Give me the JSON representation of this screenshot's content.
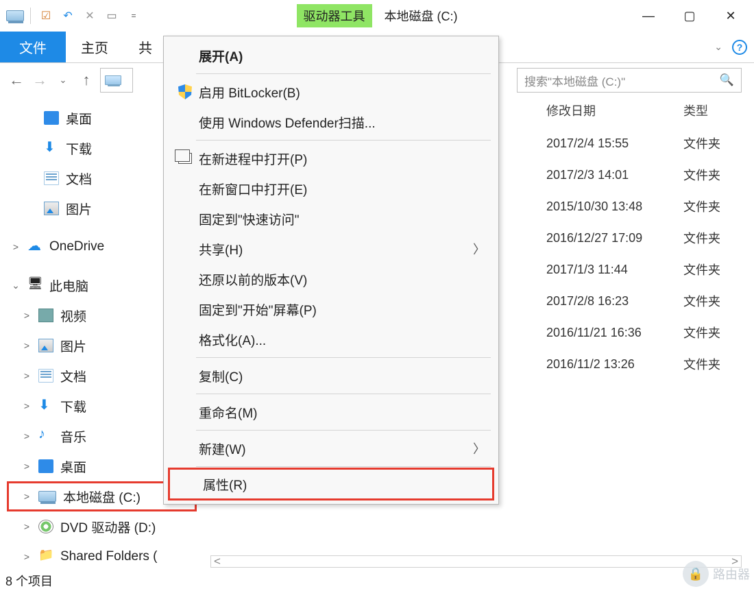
{
  "window": {
    "drive_tools_label": "驱动器工具",
    "title": "本地磁盘 (C:)"
  },
  "ribbon": {
    "file": "文件",
    "home": "主页",
    "partial": "共"
  },
  "nav": {
    "search_placeholder": "搜索\"本地磁盘 (C:)\""
  },
  "tree": {
    "quick": [
      {
        "label": "桌面",
        "icon": "desktop"
      },
      {
        "label": "下载",
        "icon": "download"
      },
      {
        "label": "文档",
        "icon": "doc"
      },
      {
        "label": "图片",
        "icon": "pic"
      }
    ],
    "onedrive": "OneDrive",
    "this_pc": "此电脑",
    "pc_children": [
      {
        "label": "视频",
        "icon": "video"
      },
      {
        "label": "图片",
        "icon": "pic"
      },
      {
        "label": "文档",
        "icon": "doc"
      },
      {
        "label": "下载",
        "icon": "download"
      },
      {
        "label": "音乐",
        "icon": "music"
      },
      {
        "label": "桌面",
        "icon": "desktop"
      },
      {
        "label": "本地磁盘 (C:)",
        "icon": "drive",
        "selected": true
      },
      {
        "label": "DVD 驱动器 (D:)",
        "icon": "dvd"
      },
      {
        "label": "Shared Folders (",
        "icon": "shared"
      }
    ]
  },
  "columns": {
    "date": "修改日期",
    "type": "类型"
  },
  "rows": [
    {
      "date": "2017/2/4 15:55",
      "type": "文件夹"
    },
    {
      "date": "2017/2/3 14:01",
      "type": "文件夹"
    },
    {
      "date": "2015/10/30 13:48",
      "type": "文件夹"
    },
    {
      "date": "2016/12/27 17:09",
      "type": "文件夹"
    },
    {
      "date": "2017/1/3 11:44",
      "type": "文件夹"
    },
    {
      "date": "2017/2/8 16:23",
      "type": "文件夹"
    },
    {
      "date": "2016/11/21 16:36",
      "type": "文件夹"
    },
    {
      "date": "2016/11/2 13:26",
      "type": "文件夹"
    }
  ],
  "context_menu": [
    {
      "label": "展开(A)",
      "bold": true
    },
    {
      "sep": true
    },
    {
      "label": "启用 BitLocker(B)",
      "icon": "shield"
    },
    {
      "label": "使用 Windows Defender扫描..."
    },
    {
      "sep": true
    },
    {
      "label": "在新进程中打开(P)",
      "icon": "newwin"
    },
    {
      "label": "在新窗口中打开(E)"
    },
    {
      "label": "固定到\"快速访问\""
    },
    {
      "label": "共享(H)",
      "submenu": true
    },
    {
      "label": "还原以前的版本(V)"
    },
    {
      "label": "固定到\"开始\"屏幕(P)"
    },
    {
      "label": "格式化(A)..."
    },
    {
      "sep": true
    },
    {
      "label": "复制(C)"
    },
    {
      "sep": true
    },
    {
      "label": "重命名(M)"
    },
    {
      "sep": true
    },
    {
      "label": "新建(W)",
      "submenu": true
    },
    {
      "sep": true
    },
    {
      "label": "属性(R)",
      "highlighted": true
    }
  ],
  "status": "8 个项目",
  "watermark": "路由器"
}
